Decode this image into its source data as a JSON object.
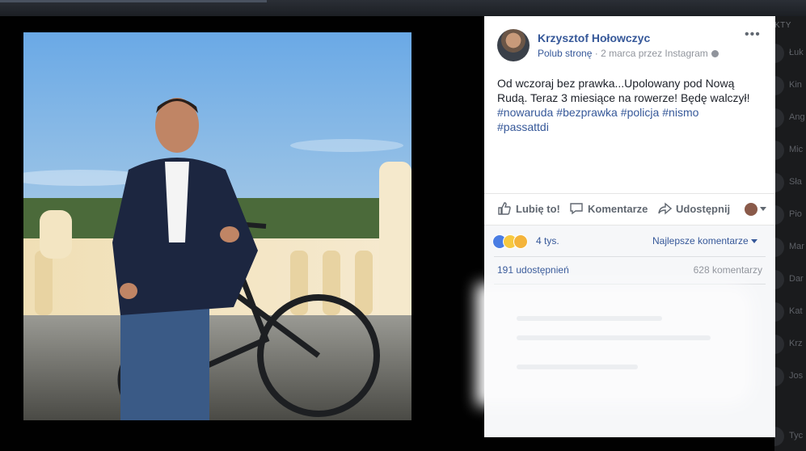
{
  "post": {
    "page_name": "Krzysztof Hołowczyc",
    "like_page": "Polub stronę",
    "separator": " · ",
    "timestamp": "2 marca przez Instagram",
    "more": "•••",
    "text": "Od wczoraj bez prawka...Upolowany pod Nową Rudą. Teraz 3 miesiące na rowerze! Będę walczył!",
    "hashtags": [
      "#nowaruda",
      "#bezprawka",
      "#policja",
      "#nismo",
      "#passattdi"
    ]
  },
  "actions": {
    "like": "Lubię to!",
    "comment": "Komentarze",
    "share": "Udostępnij"
  },
  "stats": {
    "reactions_count": "4 tys.",
    "sort_label": "Najlepsze komentarze",
    "shares": "191 udostępnień",
    "comments": "628 komentarzy"
  },
  "sidebar": {
    "title": "KTY",
    "contacts": [
      "Łuk",
      "Kin",
      "Ang",
      "Mic",
      "Sła",
      "Pio",
      "Mar",
      "Dar",
      "Kat",
      "Krz",
      "Jos",
      "Tyc"
    ]
  },
  "colors": {
    "link": "#365899",
    "secondary_text": "#90949c",
    "primary_text": "#1d2129",
    "accent": "#4267b2"
  },
  "icons": {
    "like": "thumbs-up-icon",
    "comment": "speech-bubble-icon",
    "share": "share-arrow-icon",
    "privacy": "globe-icon",
    "more": "more-options-icon"
  }
}
